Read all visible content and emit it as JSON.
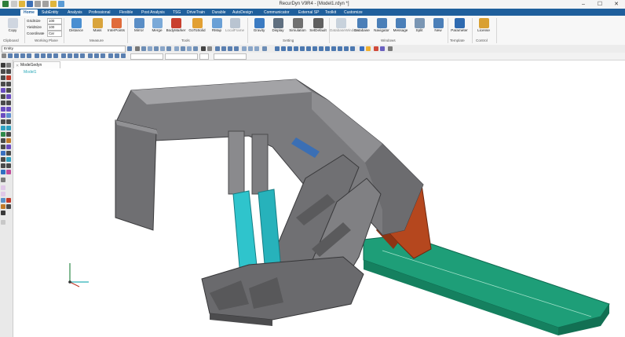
{
  "window": {
    "title": "RecurDyn V9R4 - [Model1.rdyn *]",
    "minimize": "–",
    "maximize": "☐",
    "close": "✕"
  },
  "tabs": [
    "Home",
    "SubEntity",
    "Analysis",
    "Professional",
    "Flexible",
    "Post Analysis",
    "TSG",
    "DriveTrain",
    "Durable",
    "AutoDesign",
    "Communicator",
    "External SP",
    "Toolkit",
    "Customize"
  ],
  "ribbon": {
    "clipboard": {
      "copy": "Copy",
      "group": "Clipboard"
    },
    "working_plane": {
      "group": "Working Plane",
      "rows": [
        {
          "label": "GridSize",
          "value": "100"
        },
        {
          "label": "YieldSize",
          "value": "100"
        },
        {
          "label": "Coordinate",
          "value": "Car"
        }
      ]
    },
    "measure": {
      "group": "Measure",
      "buttons": [
        "Distance",
        "Mass",
        "InterPoints"
      ]
    },
    "tools": {
      "group": "Tools",
      "buttons": [
        "Mirror",
        "Merge",
        "BodyMarker",
        "GoToSolid",
        "RMap",
        "LocalFrame"
      ]
    },
    "setting": {
      "group": "Setting",
      "buttons": [
        "Gravity",
        "Display",
        "Simulation",
        "SetDefault"
      ]
    },
    "windows": {
      "group": "Windows",
      "buttons": [
        "DatabaseWindow",
        "Database",
        "Navigator",
        "Message",
        "Split",
        "New"
      ]
    },
    "template": {
      "group": "Template",
      "buttons": [
        "Parameter"
      ]
    },
    "control": {
      "group": "Control",
      "buttons": [
        "License"
      ]
    }
  },
  "toolbar": {
    "entity_value": "Entity"
  },
  "document": {
    "tab_label": "Model1edyn",
    "sub_label": "Model1"
  },
  "colors": {
    "accent": "#1f5f9c",
    "cyan_cylinder": "#2fc4cc",
    "green_conveyor": "#1e9e78",
    "orange_part": "#b5471e",
    "gray_body": "#7a7a7d"
  }
}
